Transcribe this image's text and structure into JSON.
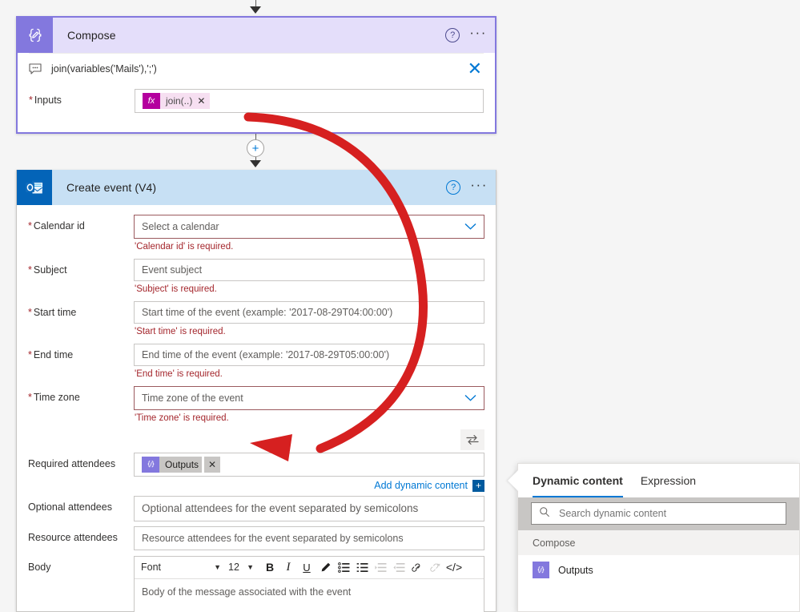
{
  "compose": {
    "title": "Compose",
    "icon": "compose-braces-icon",
    "help_label": "?",
    "more_label": "···",
    "expression": "join(variables('Mails'),';')",
    "expression_icon": "comment-icon",
    "close_label": "✕",
    "inputs": {
      "label": "Inputs",
      "required_marker": "*",
      "token": {
        "badge": "fx",
        "text": "join(..)",
        "remove": "✕"
      }
    }
  },
  "create_event": {
    "title": "Create event (V4)",
    "icon": "outlook-icon",
    "help_label": "?",
    "more_label": "···",
    "fields": {
      "calendar_id": {
        "label": "Calendar id",
        "required_marker": "*",
        "placeholder": "Select a calendar",
        "error": "'Calendar id' is required.",
        "chevron": "∨"
      },
      "subject": {
        "label": "Subject",
        "required_marker": "*",
        "placeholder": "Event subject",
        "error": "'Subject' is required."
      },
      "start_time": {
        "label": "Start time",
        "required_marker": "*",
        "placeholder": "Start time of the event (example: '2017-08-29T04:00:00')",
        "error": "'Start time' is required."
      },
      "end_time": {
        "label": "End time",
        "required_marker": "*",
        "placeholder": "End time of the event (example: '2017-08-29T05:00:00')",
        "error": "'End time' is required."
      },
      "time_zone": {
        "label": "Time zone",
        "required_marker": "*",
        "placeholder": "Time zone of the event",
        "error": "'Time zone' is required.",
        "chevron": "∨"
      },
      "required_attendees": {
        "label": "Required attendees",
        "token": {
          "badge": "{/}",
          "text": "Outputs",
          "remove": "✕"
        }
      },
      "optional_attendees": {
        "label": "Optional attendees",
        "placeholder": "Optional attendees for the event separated by semicolons"
      },
      "resource_attendees": {
        "label": "Resource attendees",
        "placeholder": "Resource attendees for the event separated by semicolons"
      },
      "body": {
        "label": "Body",
        "placeholder": "Body of the message associated with the event",
        "toolbar": {
          "font_value": "Font",
          "size_value": "12",
          "bold": "B",
          "italic": "I",
          "underline": "U",
          "buttons": [
            "highlight-pen-icon",
            "bulleted-list-icon",
            "numbered-list-icon",
            "indent-icon",
            "outdent-icon",
            "link-icon",
            "unlink-icon",
            "code-icon"
          ]
        }
      }
    },
    "swap_icon": "swap-arrows-icon",
    "add_dynamic_content": {
      "label": "Add dynamic content",
      "plus": "+"
    }
  },
  "dynamic_panel": {
    "tabs": [
      {
        "label": "Dynamic content",
        "active": true
      },
      {
        "label": "Expression",
        "active": false
      }
    ],
    "search_placeholder": "Search dynamic content",
    "search_value": "",
    "search_icon": "search-icon",
    "groups": [
      {
        "name": "Compose",
        "items": [
          {
            "icon": "compose-braces-icon",
            "name": "Outputs"
          }
        ]
      }
    ]
  },
  "annotation": {
    "type": "red-curved-arrow",
    "color": "#d62020",
    "description": "arrow from Inputs token to Required attendees"
  },
  "colors": {
    "compose_accent": "#8378de",
    "compose_header": "#e4defa",
    "outlook_accent": "#0364b8",
    "event_header": "#c7e0f4",
    "link": "#0078d4",
    "error": "#a4262c",
    "annotation": "#d62020"
  }
}
